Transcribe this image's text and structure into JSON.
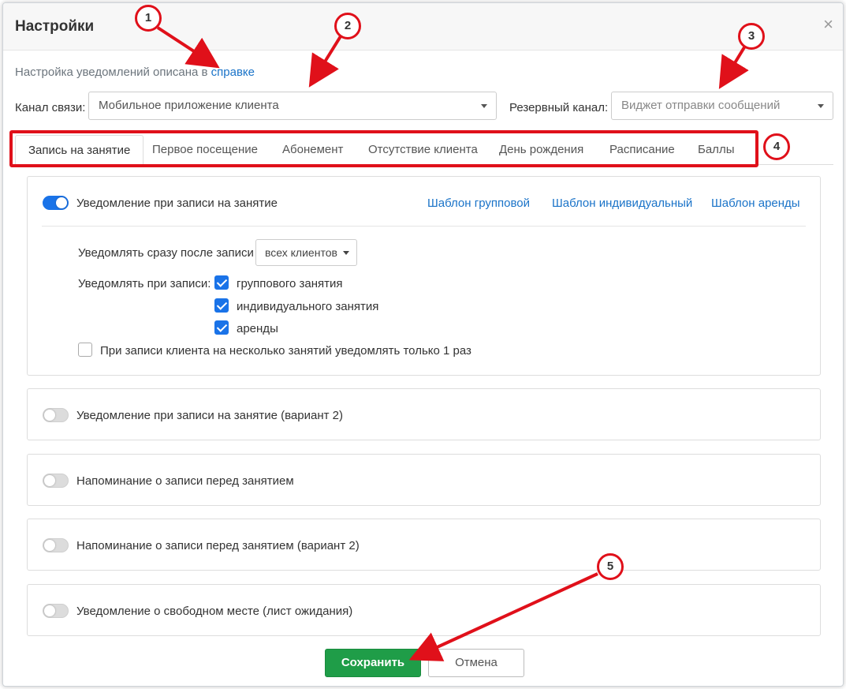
{
  "dialog": {
    "title": "Настройки",
    "close_glyph": "×"
  },
  "help": {
    "text": "Настройка уведомлений описана в ",
    "link": "справке"
  },
  "channel": {
    "label": "Канал связи:",
    "value": "Мобильное приложение клиента",
    "backup_label": "Резервный канал:",
    "backup_placeholder": "Виджет отправки сообщений"
  },
  "tabs": [
    {
      "label": "Запись на занятие",
      "active": true
    },
    {
      "label": "Первое посещение"
    },
    {
      "label": "Абонемент"
    },
    {
      "label": "Отсутствие клиента"
    },
    {
      "label": "День рождения"
    },
    {
      "label": "Расписание"
    },
    {
      "label": "Баллы"
    }
  ],
  "main_panel": {
    "toggle_label": "Уведомление при записи на занятие",
    "enabled": true,
    "links": [
      "Шаблон групповой",
      "Шаблон индивидуальный",
      "Шаблон аренды"
    ],
    "notify_after_label": "Уведомлять сразу после записи",
    "notify_after_value": "всех клиентов",
    "notify_on_label": "Уведомлять при записи:",
    "checkboxes": [
      {
        "label": "группового занятия",
        "checked": true
      },
      {
        "label": "индивидуального занятия",
        "checked": true
      },
      {
        "label": "аренды",
        "checked": true
      }
    ],
    "once_label": "При записи клиента на несколько занятий уведомлять только 1 раз",
    "once_checked": false
  },
  "other_panels": [
    {
      "label": "Уведомление при записи на занятие (вариант 2)",
      "enabled": false
    },
    {
      "label": "Напоминание о записи перед занятием",
      "enabled": false
    },
    {
      "label": "Напоминание о записи перед занятием (вариант 2)",
      "enabled": false
    },
    {
      "label": "Уведомление о свободном месте (лист ожидания)",
      "enabled": false
    }
  ],
  "buttons": {
    "save": "Сохранить",
    "cancel": "Отмена"
  },
  "annotations": [
    "1",
    "2",
    "3",
    "4",
    "5"
  ],
  "colors": {
    "accent": "#1a73e8",
    "save": "#1f9d48",
    "annotation": "#e0101a"
  }
}
